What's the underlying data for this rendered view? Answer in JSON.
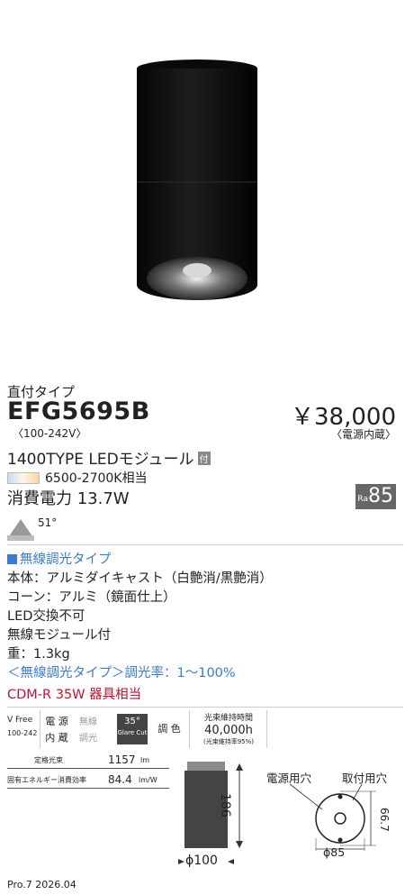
{
  "product": {
    "mount_type": "直付タイプ",
    "model": "EFG5695B",
    "voltage": "〈100-242V〉",
    "price": "￥38,000",
    "price_note": "〈電源内蔵〉",
    "module": "1400TYPE LEDモジュール",
    "module_badge": "付",
    "cct": "6500-2700K相当",
    "power": "消費電力 13.7W",
    "ra_label": "Ra",
    "ra_value": "85",
    "beam_angle": "51°"
  },
  "spec": {
    "section_title": "無線調光タイプ",
    "lines": [
      "本体：アルミダイキャスト（白艶消/黒艶消）",
      "コーン：アルミ（鏡面仕上）",
      "LED交換不可",
      "無線モジュール付",
      "重：1.3kg"
    ],
    "dimming": "＜無線調光タイプ＞調光率：1～100%",
    "equivalent": "CDM-R 35W 器具相当"
  },
  "icons": {
    "vfree_title": "V Free",
    "vfree_sub": "100-242",
    "power_1": "電 源",
    "power_2": "内 蔵",
    "wireless_1": "無線",
    "wireless_2": "調光",
    "glare_deg": "35°",
    "glare_label": "Glare Cut",
    "color_adjust": "調 色",
    "lifetime_label": "光束維持時間",
    "lifetime_value": "40,000h",
    "lifetime_note": "(光束維持率95%)"
  },
  "performance": {
    "flux_label": "定格光束",
    "flux_value": "1157",
    "flux_unit": "lm",
    "eff_label": "固有エネルギー消費効率",
    "eff_value": "84.4",
    "eff_unit": "lm/W"
  },
  "dimensions": {
    "height": "186",
    "diameter": "ϕ100",
    "label_power_hole": "電源用穴",
    "label_mount_hole": "取付用穴",
    "pitch": "66.7",
    "hole_dia": "ϕ85"
  },
  "footer": "Pro.7 2026.04",
  "colors": {
    "accent_blue": "#3a7bd5",
    "accent_red": "#c8102e",
    "body": "#111111"
  }
}
